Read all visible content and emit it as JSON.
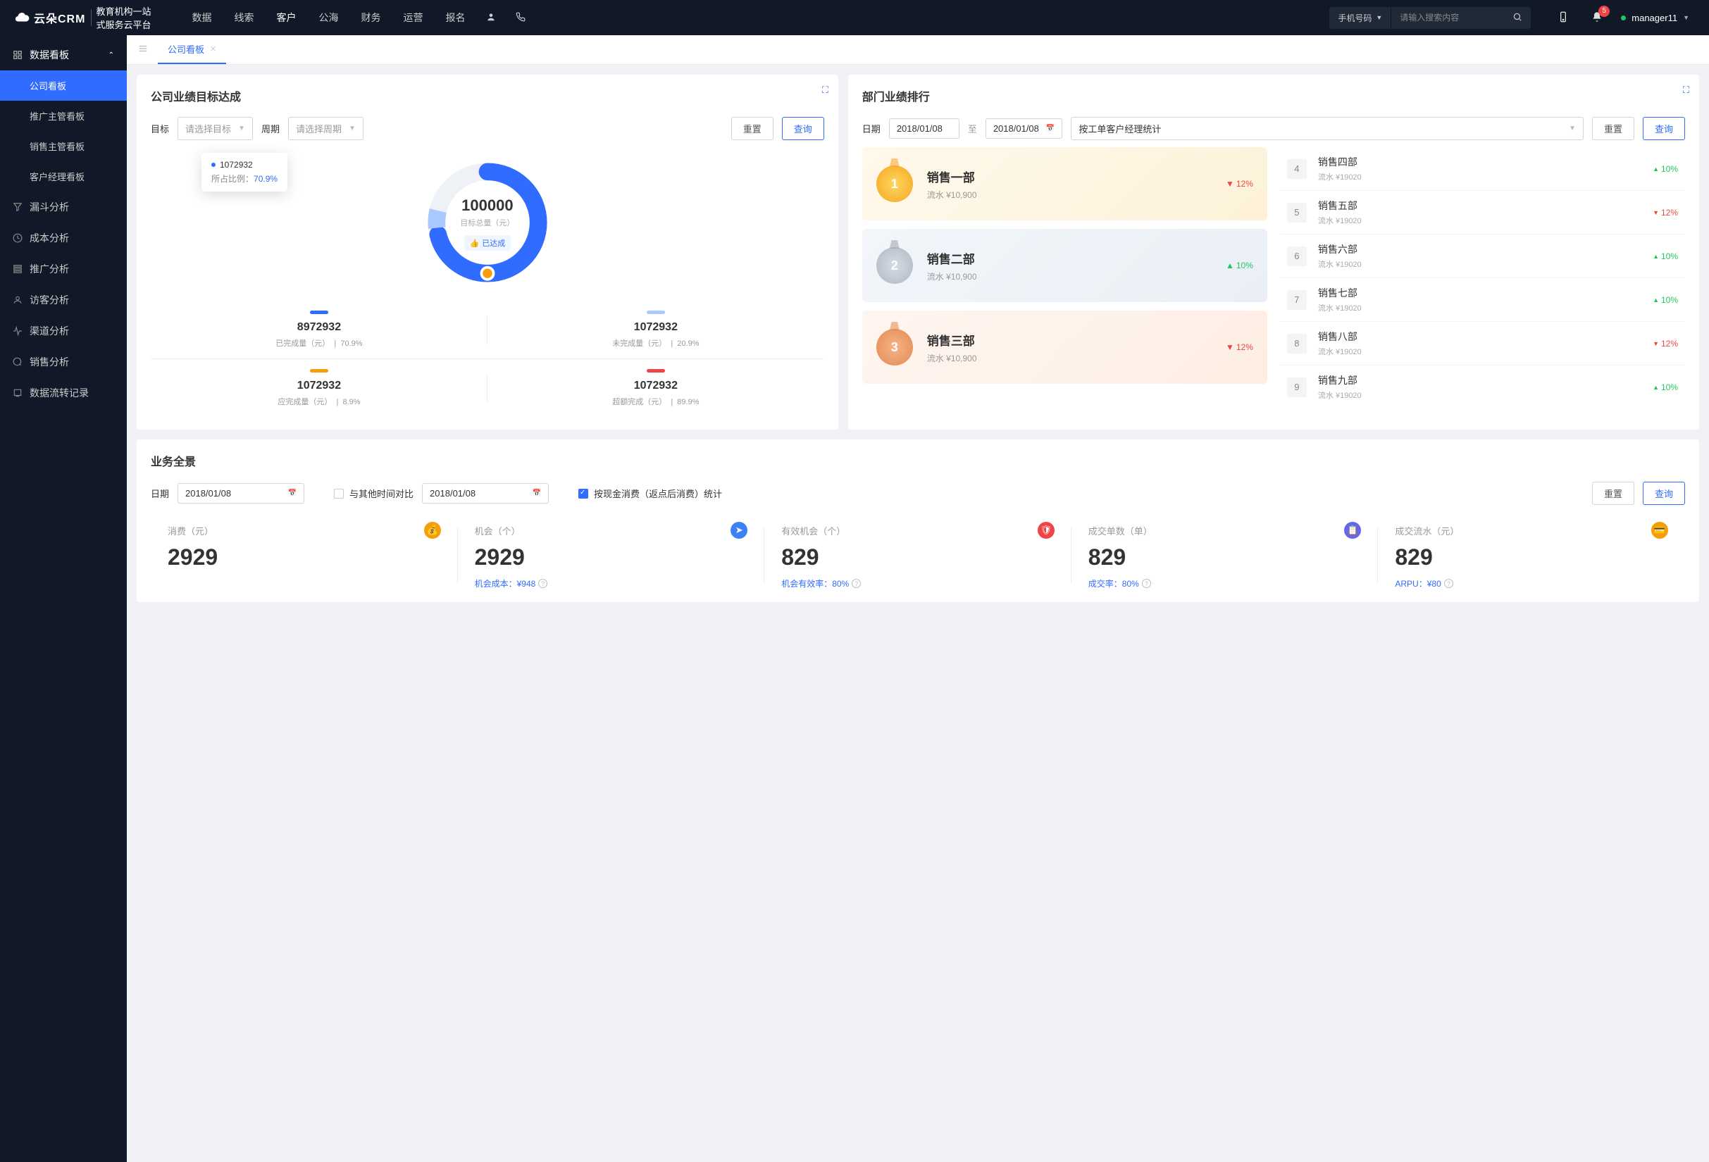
{
  "header": {
    "logo_main": "云朵CRM",
    "logo_sub1": "教育机构一站",
    "logo_sub2": "式服务云平台",
    "nav": [
      "数据",
      "线索",
      "客户",
      "公海",
      "财务",
      "运营",
      "报名"
    ],
    "nav_active": 2,
    "search_type": "手机号码",
    "search_placeholder": "请输入搜索内容",
    "notification_count": "5",
    "username": "manager11"
  },
  "sidebar": {
    "group_title": "数据看板",
    "items": [
      "公司看板",
      "推广主管看板",
      "销售主管看板",
      "客户经理看板"
    ],
    "active": 0,
    "links": [
      "漏斗分析",
      "成本分析",
      "推广分析",
      "访客分析",
      "渠道分析",
      "销售分析",
      "数据流转记录"
    ]
  },
  "tab": {
    "label": "公司看板"
  },
  "card_goal": {
    "title": "公司业绩目标达成",
    "lbl_target": "目标",
    "sel_target": "请选择目标",
    "lbl_period": "周期",
    "sel_period": "请选择周期",
    "btn_reset": "重置",
    "btn_query": "查询",
    "tooltip_val": "1072932",
    "tooltip_ratio_lbl": "所占比例：",
    "tooltip_ratio": "70.9%",
    "center_val": "100000",
    "center_sub": "目标总量（元）",
    "center_badge": "已达成",
    "stats": [
      {
        "c": "blue",
        "val": "8972932",
        "lab": "已完成量（元）",
        "pct": "70.9%"
      },
      {
        "c": "lblue",
        "val": "1072932",
        "lab": "未完成量（元）",
        "pct": "20.9%"
      },
      {
        "c": "orange",
        "val": "1072932",
        "lab": "应完成量（元）",
        "pct": "8.9%"
      },
      {
        "c": "red",
        "val": "1072932",
        "lab": "超额完成（元）",
        "pct": "89.9%"
      }
    ]
  },
  "card_rank": {
    "title": "部门业绩排行",
    "lbl_date": "日期",
    "date1": "2018/01/08",
    "to": "至",
    "date2": "2018/01/08",
    "select_by": "按工单客户经理统计",
    "btn_reset": "重置",
    "btn_query": "查询",
    "top3": [
      {
        "rank": "1",
        "name": "销售一部",
        "sub": "流水 ¥10,900",
        "dir": "down",
        "pct": "12%"
      },
      {
        "rank": "2",
        "name": "销售二部",
        "sub": "流水 ¥10,900",
        "dir": "up",
        "pct": "10%"
      },
      {
        "rank": "3",
        "name": "销售三部",
        "sub": "流水 ¥10,900",
        "dir": "down",
        "pct": "12%"
      }
    ],
    "rest": [
      {
        "rank": "4",
        "name": "销售四部",
        "sub": "流水 ¥19020",
        "dir": "up",
        "pct": "10%"
      },
      {
        "rank": "5",
        "name": "销售五部",
        "sub": "流水 ¥19020",
        "dir": "down",
        "pct": "12%"
      },
      {
        "rank": "6",
        "name": "销售六部",
        "sub": "流水 ¥19020",
        "dir": "up",
        "pct": "10%"
      },
      {
        "rank": "7",
        "name": "销售七部",
        "sub": "流水 ¥19020",
        "dir": "up",
        "pct": "10%"
      },
      {
        "rank": "8",
        "name": "销售八部",
        "sub": "流水 ¥19020",
        "dir": "down",
        "pct": "12%"
      },
      {
        "rank": "9",
        "name": "销售九部",
        "sub": "流水 ¥19020",
        "dir": "up",
        "pct": "10%"
      }
    ]
  },
  "card_pano": {
    "title": "业务全景",
    "lbl_date": "日期",
    "date": "2018/01/08",
    "compare_lbl": "与其他时间对比",
    "date2": "2018/01/08",
    "stat_lbl": "按现金消费（返点后消费）统计",
    "btn_reset": "重置",
    "btn_query": "查询",
    "cells": [
      {
        "lbl": "消费（元）",
        "ic": "orange",
        "val": "2929",
        "foot": ""
      },
      {
        "lbl": "机会（个）",
        "ic": "blue",
        "val": "2929",
        "foot": "机会成本：¥948"
      },
      {
        "lbl": "有效机会（个）",
        "ic": "red",
        "val": "829",
        "foot": "机会有效率：80%"
      },
      {
        "lbl": "成交单数（单）",
        "ic": "purple",
        "val": "829",
        "foot": "成交率：80%"
      },
      {
        "lbl": "成交流水（元）",
        "ic": "yellow",
        "val": "829",
        "foot": "ARPU：¥80"
      }
    ]
  },
  "chart_data": {
    "type": "pie",
    "title": "目标总量（元） 100000",
    "series": [
      {
        "name": "已完成量",
        "value": 8972932,
        "ratio": 70.9,
        "color": "#2f6cff"
      },
      {
        "name": "未完成量",
        "value": 1072932,
        "ratio": 20.9,
        "color": "#a8caff"
      },
      {
        "name": "应完成量",
        "value": 1072932,
        "ratio": 8.9,
        "color": "#f59e0b"
      },
      {
        "name": "超额完成",
        "value": 1072932,
        "ratio": 89.9,
        "color": "#ef4444"
      }
    ],
    "highlighted": {
      "value": 1072932,
      "ratio": 70.9
    }
  }
}
